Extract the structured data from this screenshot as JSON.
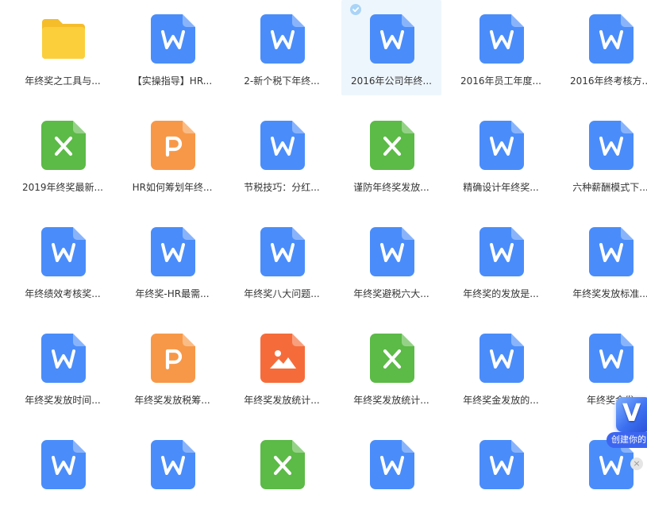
{
  "files": [
    {
      "name": "年终奖之工具与...",
      "type": "folder",
      "selected": false
    },
    {
      "name": "【实操指导】HR...",
      "type": "word",
      "selected": false
    },
    {
      "name": "2-新个税下年终...",
      "type": "word",
      "selected": false
    },
    {
      "name": "2016年公司年终...",
      "type": "word",
      "selected": true
    },
    {
      "name": "2016年员工年度...",
      "type": "word",
      "selected": false
    },
    {
      "name": "2016年终考核方...",
      "type": "word",
      "selected": false
    },
    {
      "name": "2019年终奖最新...",
      "type": "excel",
      "selected": false
    },
    {
      "name": "HR如何筹划年终...",
      "type": "ppt",
      "selected": false
    },
    {
      "name": "节税技巧：分红...",
      "type": "word",
      "selected": false
    },
    {
      "name": "谨防年终奖发放...",
      "type": "excel",
      "selected": false
    },
    {
      "name": "精确设计年终奖...",
      "type": "word",
      "selected": false
    },
    {
      "name": "六种薪酬模式下...",
      "type": "word",
      "selected": false
    },
    {
      "name": "年终绩效考核奖...",
      "type": "word",
      "selected": false
    },
    {
      "name": "年终奖-HR最需...",
      "type": "word",
      "selected": false
    },
    {
      "name": "年终奖八大问题...",
      "type": "word",
      "selected": false
    },
    {
      "name": "年终奖避税六大...",
      "type": "word",
      "selected": false
    },
    {
      "name": "年终奖的发放是...",
      "type": "word",
      "selected": false
    },
    {
      "name": "年终奖发放标准...",
      "type": "word",
      "selected": false
    },
    {
      "name": "年终奖发放时间...",
      "type": "word",
      "selected": false
    },
    {
      "name": "年终奖发放税筹...",
      "type": "ppt",
      "selected": false
    },
    {
      "name": "年终奖发放统计...",
      "type": "image",
      "selected": false
    },
    {
      "name": "年终奖发放统计...",
      "type": "excel",
      "selected": false
    },
    {
      "name": "年终奖金发放的...",
      "type": "word",
      "selected": false
    },
    {
      "name": "年终奖金发",
      "type": "word",
      "selected": false
    },
    {
      "name": "",
      "type": "word",
      "selected": false
    },
    {
      "name": "",
      "type": "word",
      "selected": false
    },
    {
      "name": "",
      "type": "excel",
      "selected": false
    },
    {
      "name": "",
      "type": "word",
      "selected": false
    },
    {
      "name": "",
      "type": "word",
      "selected": false
    },
    {
      "name": "",
      "type": "word",
      "selected": false
    }
  ],
  "colors": {
    "word": "#4a8dfa",
    "excel": "#5cba47",
    "ppt": "#f79848",
    "image": "#f56c3a",
    "folder": "#fbcf3b",
    "selected_bg": "#eef6fd"
  },
  "icon_names": {
    "word": "word-file-icon",
    "excel": "excel-file-icon",
    "ppt": "ppt-file-icon",
    "image": "image-file-icon",
    "folder": "folder-icon"
  },
  "widget": {
    "logo_letter": "V",
    "label": "创建你的"
  }
}
